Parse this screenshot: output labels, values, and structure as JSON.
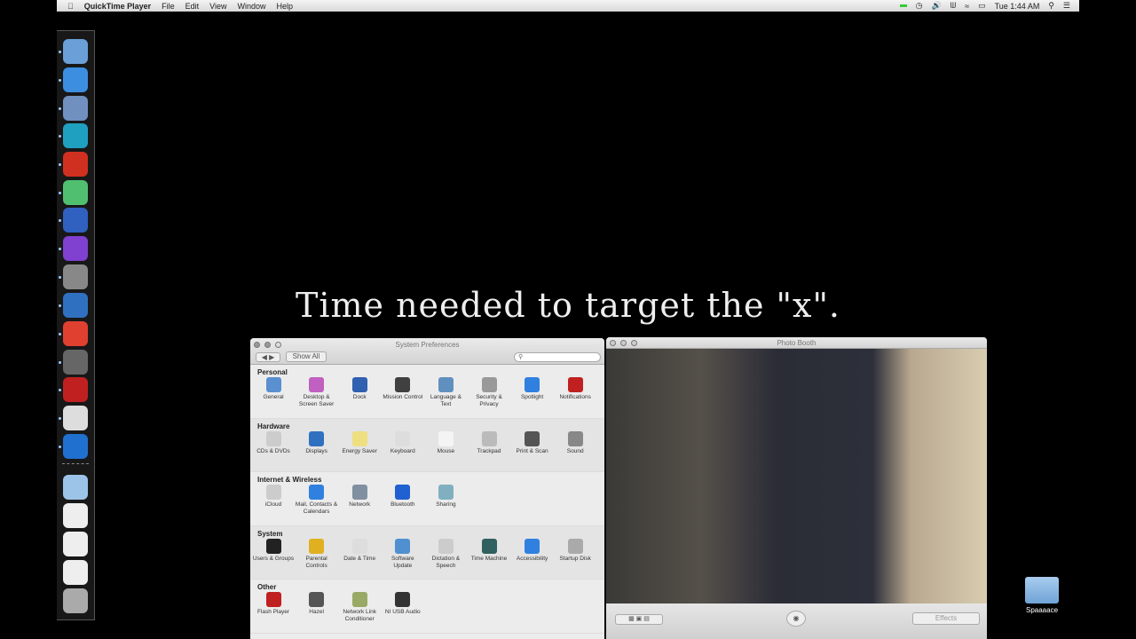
{
  "menubar": {
    "app": "QuickTime Player",
    "items": [
      "File",
      "Edit",
      "View",
      "Window",
      "Help"
    ],
    "clock": "Tue 1:44 AM"
  },
  "caption": "Time needed to target the \"x\".",
  "sysprefs": {
    "title": "System Preferences",
    "show_all": "Show All",
    "search_placeholder": "",
    "sections": [
      {
        "title": "Personal",
        "items": [
          [
            "General",
            "#5a8fd0"
          ],
          [
            "Desktop & Screen Saver",
            "#c060c0"
          ],
          [
            "Dock",
            "#3060b0"
          ],
          [
            "Mission Control",
            "#404040"
          ],
          [
            "Language & Text",
            "#6090c0"
          ],
          [
            "Security & Privacy",
            "#999"
          ],
          [
            "Spotlight",
            "#3080e0"
          ],
          [
            "Notifications",
            "#c02020"
          ]
        ]
      },
      {
        "title": "Hardware",
        "items": [
          [
            "CDs & DVDs",
            "#ccc"
          ],
          [
            "Displays",
            "#3070c0"
          ],
          [
            "Energy Saver",
            "#eee080"
          ],
          [
            "Keyboard",
            "#ddd"
          ],
          [
            "Mouse",
            "#f4f4f4"
          ],
          [
            "Trackpad",
            "#bbb"
          ],
          [
            "Print & Scan",
            "#555"
          ],
          [
            "Sound",
            "#888"
          ]
        ]
      },
      {
        "title": "Internet & Wireless",
        "items": [
          [
            "iCloud",
            "#ccc"
          ],
          [
            "Mail, Contacts & Calendars",
            "#3080e0"
          ],
          [
            "Network",
            "#8090a0"
          ],
          [
            "Bluetooth",
            "#2060d0"
          ],
          [
            "Sharing",
            "#80b0c0"
          ]
        ]
      },
      {
        "title": "System",
        "items": [
          [
            "Users & Groups",
            "#222"
          ],
          [
            "Parental Controls",
            "#e0b020"
          ],
          [
            "Date & Time",
            "#ddd"
          ],
          [
            "Software Update",
            "#5090d0"
          ],
          [
            "Dictation & Speech",
            "#ccc"
          ],
          [
            "Time Machine",
            "#306060"
          ],
          [
            "Accessibility",
            "#3080e0"
          ],
          [
            "Startup Disk",
            "#aaa"
          ]
        ]
      },
      {
        "title": "Other",
        "items": [
          [
            "Flash Player",
            "#c02020"
          ],
          [
            "Hazel",
            "#555"
          ],
          [
            "Network Link Conditioner",
            "#9a6"
          ],
          [
            "NI USB Audio",
            "#333"
          ]
        ]
      }
    ]
  },
  "photobooth": {
    "title": "Photo Booth",
    "effects": "Effects"
  },
  "desktop": {
    "folder": "Spaaaace"
  },
  "dock": {
    "colors": [
      "#6a9fd8",
      "#3b8ee0",
      "#7090c0",
      "#20a0c0",
      "#d03020",
      "#50c070",
      "#3060c0",
      "#8040d0",
      "#888",
      "#3070c0",
      "#e04030",
      "#666",
      "#c02020",
      "#ddd",
      "#2070d0",
      "#9cc4e8",
      "#eee",
      "#eee",
      "#eee",
      "#aaa"
    ]
  }
}
